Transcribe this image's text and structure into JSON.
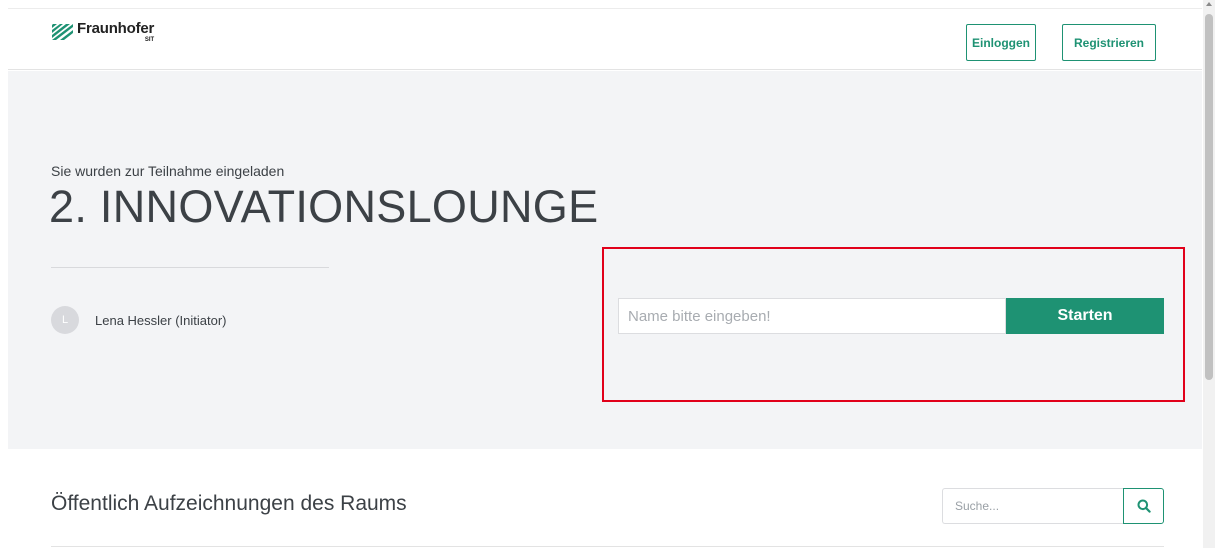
{
  "header": {
    "logo_name": "Fraunhofer",
    "logo_sub": "SIT",
    "login_label": "Einloggen",
    "register_label": "Registrieren"
  },
  "hero": {
    "invite_text": "Sie wurden zur Teilnahme eingeladen",
    "room_title": "2. INNOVATIONSLOUNGE",
    "owner_initial": "L",
    "owner_name": "Lena Hessler (Initiator)",
    "name_placeholder": "Name bitte eingeben!",
    "start_label": "Starten"
  },
  "recordings": {
    "title": "Öffentlich Aufzeichnungen des Raums",
    "search_placeholder": "Suche..."
  },
  "colors": {
    "accent": "#1e9273",
    "highlight": "#e1001a",
    "hero_bg": "#f3f4f6"
  },
  "icons": {
    "search": "search-icon",
    "logo": "fraunhofer-logo-icon"
  }
}
